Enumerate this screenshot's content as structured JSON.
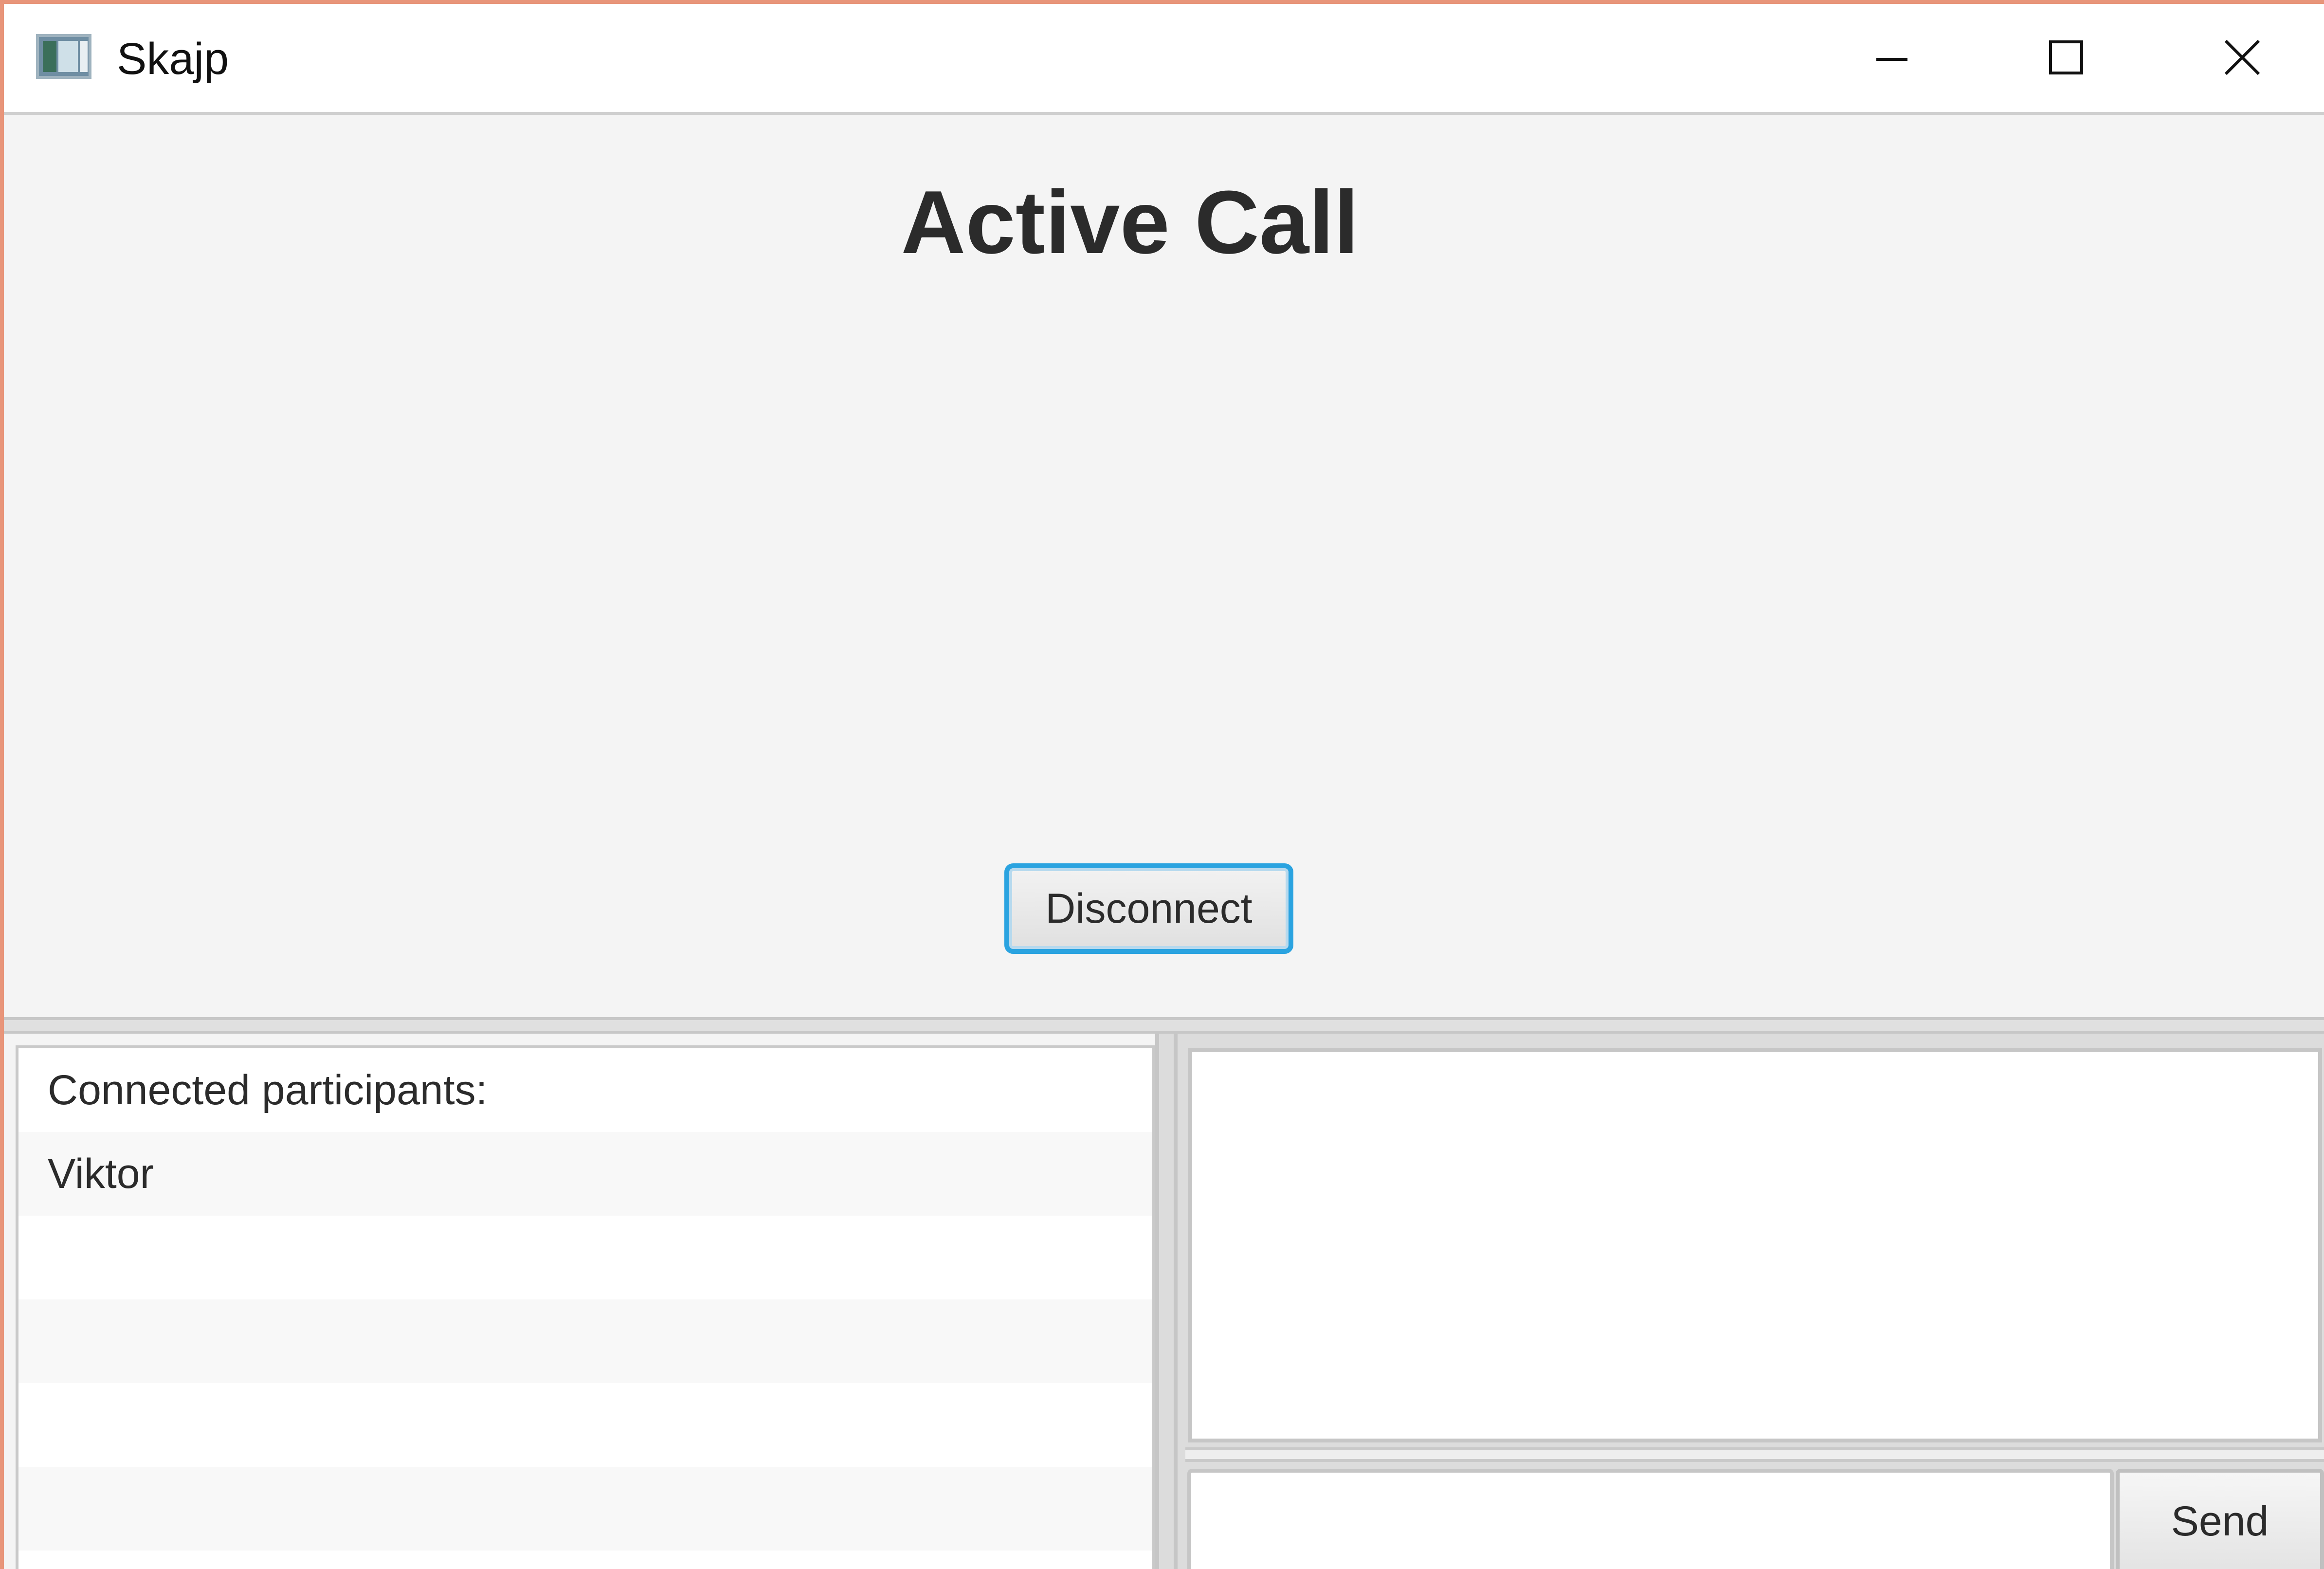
{
  "window": {
    "title": "Skajp",
    "controls": [
      "minimize-icon",
      "maximize-icon",
      "close-icon"
    ]
  },
  "call": {
    "title": "Active Call",
    "disconnect_label": "Disconnect"
  },
  "participants": {
    "header": "Connected participants:",
    "items": [
      "Viktor"
    ]
  },
  "chat": {
    "message_value": "",
    "message_placeholder": "",
    "send_label": "Send"
  },
  "colors": {
    "accent_focus": "#2aa3e0",
    "window_border": "#e8957a"
  }
}
